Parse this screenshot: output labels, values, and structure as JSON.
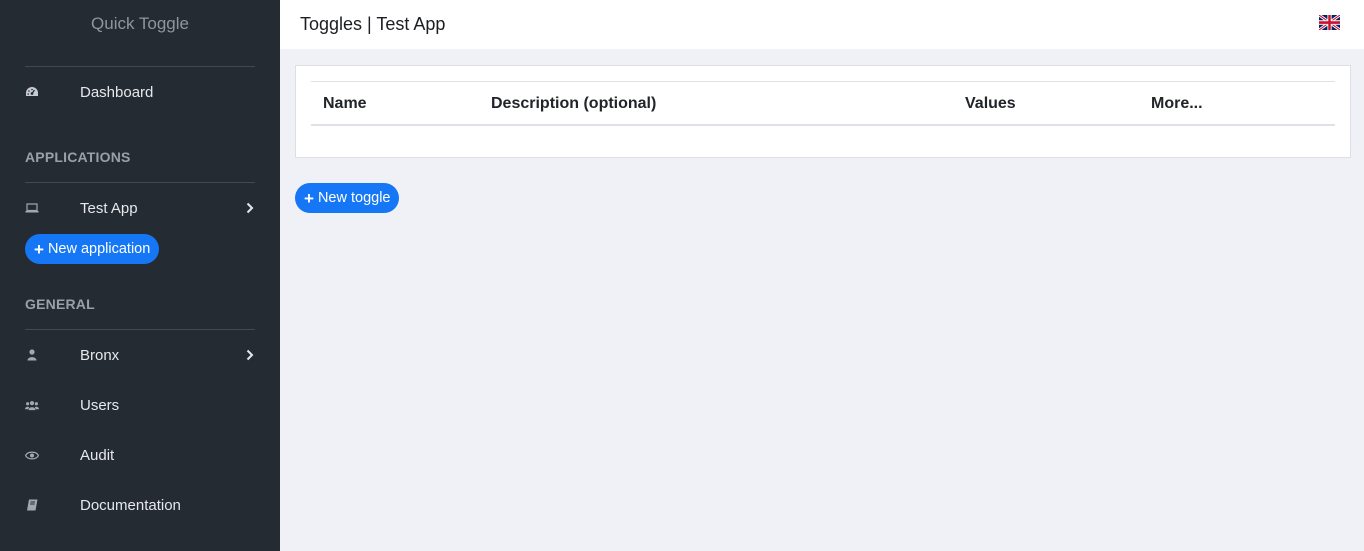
{
  "sidebar": {
    "brand": "Quick Toggle",
    "dashboard": {
      "label": "Dashboard",
      "icon": "tachometer-icon"
    },
    "applications_title": "APPLICATIONS",
    "applications": [
      {
        "label": "Test App",
        "icon": "laptop-icon"
      }
    ],
    "new_application_label": "New application",
    "general_title": "GENERAL",
    "general": [
      {
        "label": "Bronx",
        "icon": "user-icon"
      },
      {
        "label": "Users",
        "icon": "users-icon"
      },
      {
        "label": "Audit",
        "icon": "eye-icon"
      },
      {
        "label": "Documentation",
        "icon": "book-icon"
      }
    ]
  },
  "header": {
    "title": "Toggles | Test App",
    "language_flag": "uk-flag-icon"
  },
  "table": {
    "columns": [
      "Name",
      "Description (optional)",
      "Values",
      "More..."
    ],
    "rows": []
  },
  "new_toggle_label": "New toggle",
  "colors": {
    "sidebar_bg": "#252b33",
    "accent": "#1577f5",
    "page_bg": "#f0f1f6"
  }
}
